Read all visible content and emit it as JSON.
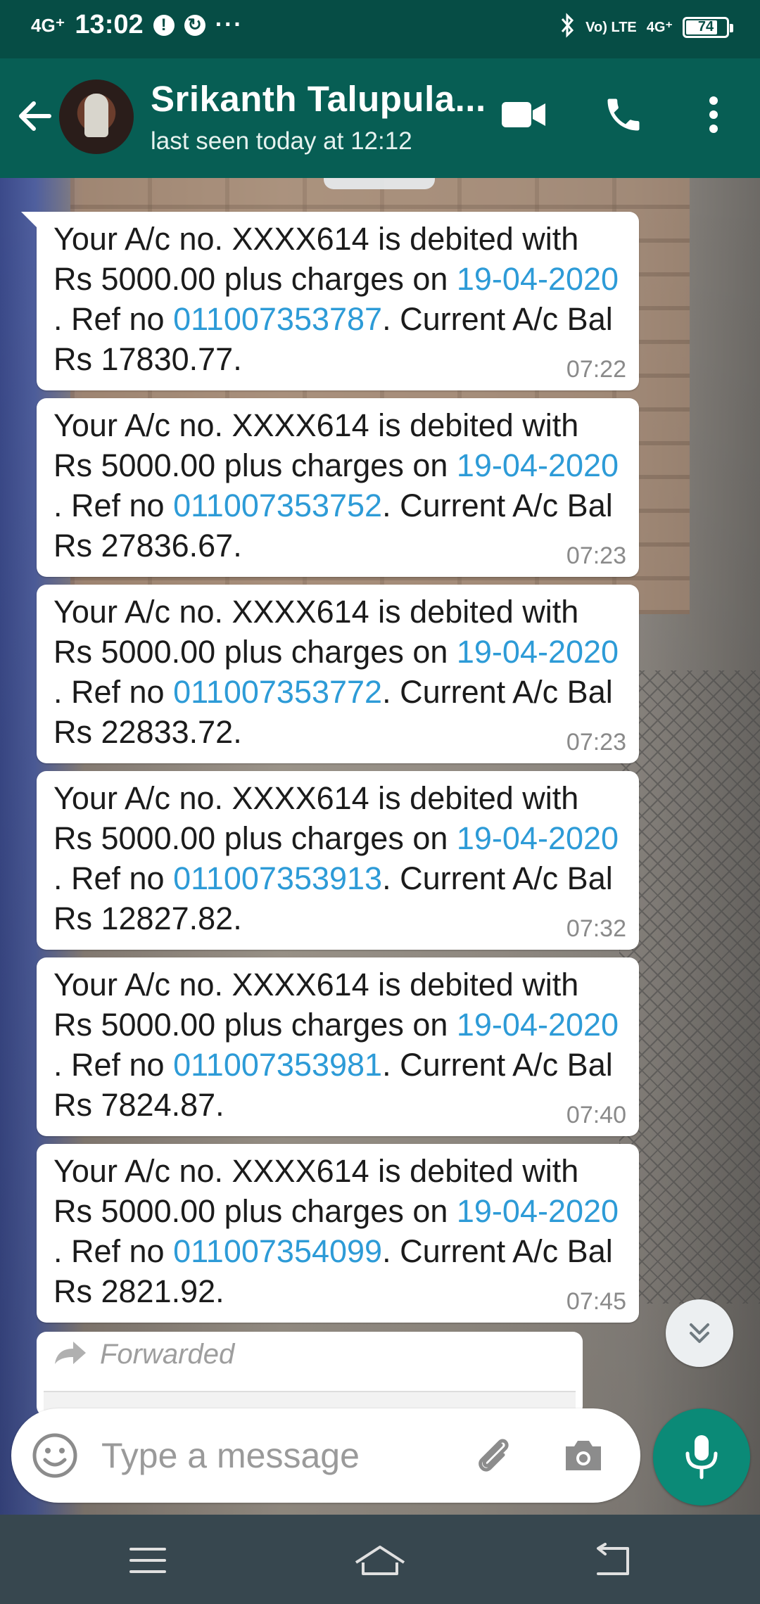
{
  "status_bar": {
    "network": "4G⁺",
    "time": "13:02",
    "overflow": "···",
    "volte": "Vo) LTE",
    "network_right": "4G⁺",
    "battery": "74"
  },
  "header": {
    "contact_name": "Srikanth Talupula...",
    "last_seen": "last seen today at 12:12"
  },
  "messages": [
    {
      "p1": "Your A/c no. XXXX614 is debited with Rs 5000.00 plus charges on ",
      "date": "19-04-2020",
      "p2": " . Ref no ",
      "ref": "011007353787",
      "p3": ". Current A/c Bal Rs 17830.77.",
      "time": "07:22"
    },
    {
      "p1": "Your A/c no. XXXX614 is debited with Rs 5000.00 plus charges on ",
      "date": "19-04-2020",
      "p2": " . Ref no ",
      "ref": "011007353752",
      "p3": ". Current A/c Bal Rs 27836.67.",
      "time": "07:23"
    },
    {
      "p1": "Your A/c no. XXXX614 is debited with Rs 5000.00 plus charges on ",
      "date": "19-04-2020",
      "p2": " . Ref no ",
      "ref": "011007353772",
      "p3": ". Current A/c Bal Rs 22833.72.",
      "time": "07:23"
    },
    {
      "p1": "Your A/c no. XXXX614 is debited with Rs 5000.00 plus charges on ",
      "date": "19-04-2020",
      "p2": " . Ref no ",
      "ref": "011007353913",
      "p3": ". Current A/c Bal Rs 12827.82.",
      "time": "07:32"
    },
    {
      "p1": "Your A/c no. XXXX614 is debited with Rs 5000.00 plus charges on ",
      "date": "19-04-2020",
      "p2": " . Ref no ",
      "ref": "011007353981",
      "p3": ". Current A/c Bal Rs 7824.87.",
      "time": "07:40"
    },
    {
      "p1": "Your A/c no. XXXX614 is debited with Rs 5000.00 plus charges on ",
      "date": "19-04-2020",
      "p2": " . Ref no ",
      "ref": "011007354099",
      "p3": ". Current A/c Bal Rs 2821.92.",
      "time": "07:45"
    }
  ],
  "forwarded": {
    "label": "Forwarded"
  },
  "input": {
    "placeholder": "Type a message"
  },
  "icons": {
    "back": "arrow-left-icon",
    "video": "video-call-icon",
    "call": "phone-icon",
    "menu": "more-vertical-icon",
    "emoji": "emoji-icon",
    "attach": "paperclip-icon",
    "camera": "camera-icon",
    "mic": "microphone-icon",
    "scroll": "chevrons-down-icon"
  },
  "colors": {
    "header": "#075e54",
    "status_bar": "#064d45",
    "link": "#2d9bd7",
    "mic_button": "#0b8a77",
    "nav_bar": "#37474f"
  }
}
